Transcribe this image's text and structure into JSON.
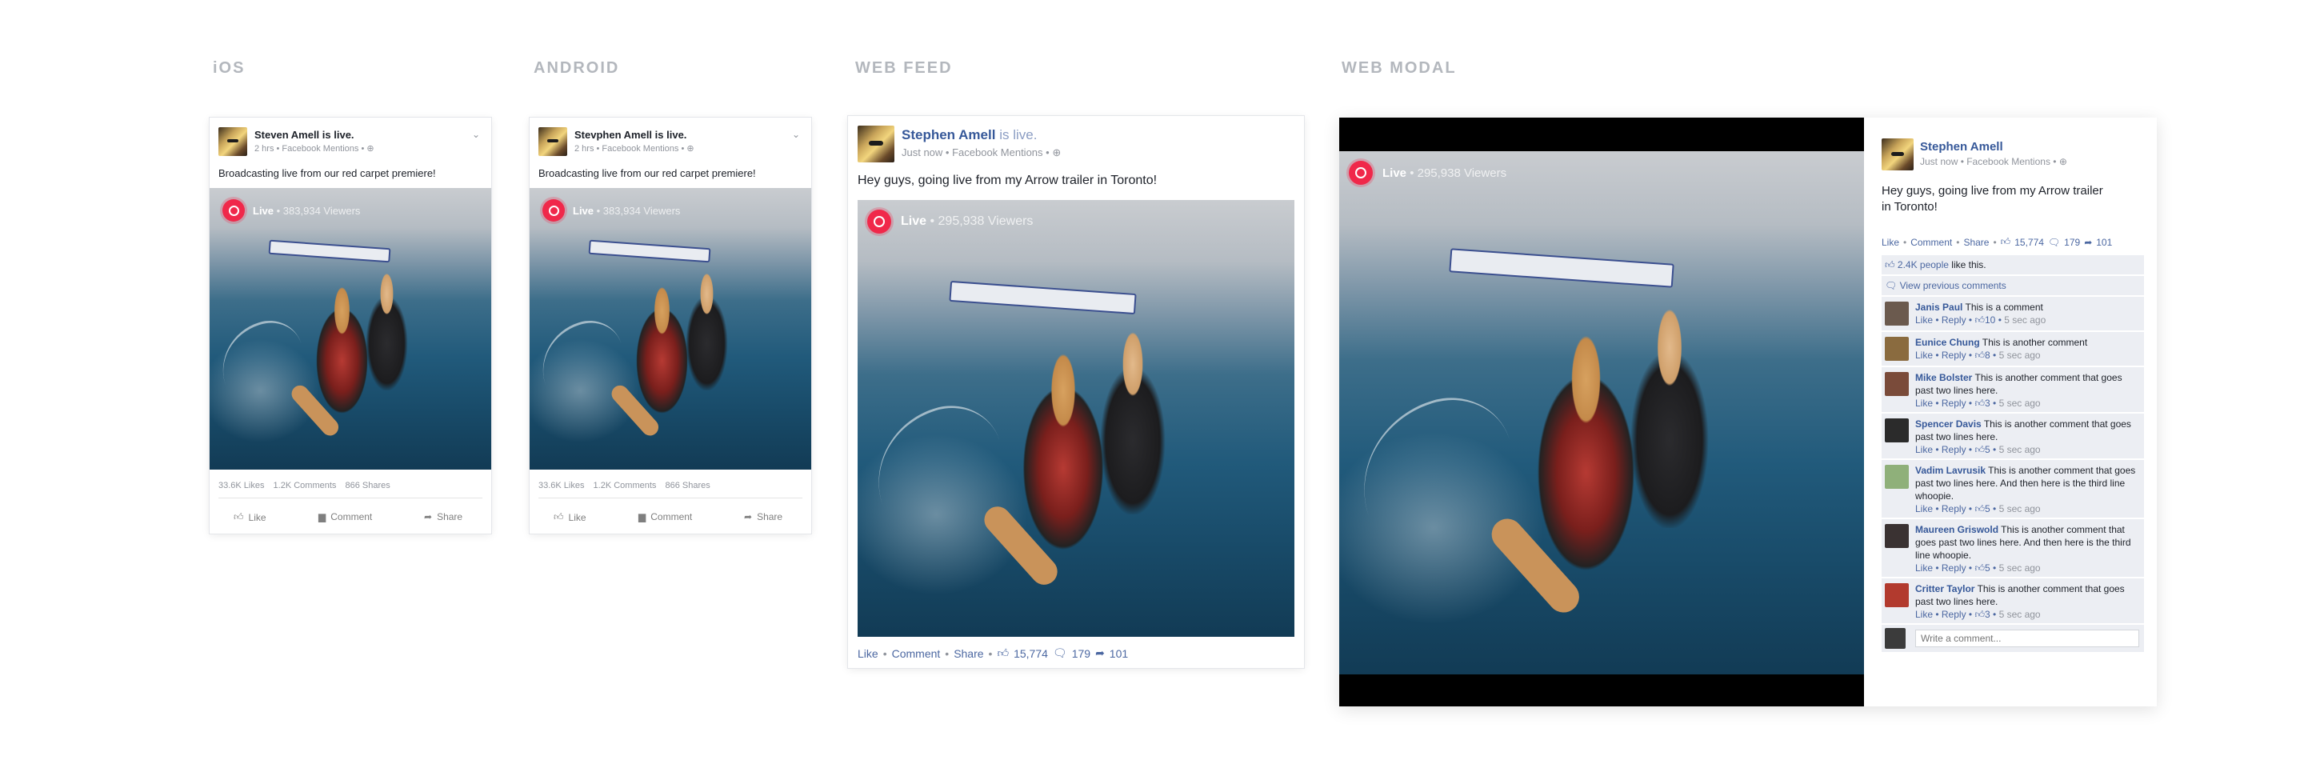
{
  "sections": {
    "ios": "iOS",
    "android": "ANDROID",
    "web_feed": "WEB FEED",
    "web_modal": "WEB MODAL"
  },
  "ios_card": {
    "author": "Steven Amell",
    "is_live_text": "is live.",
    "meta": "2 hrs • Facebook Mentions •",
    "message": "Broadcasting live from our red carpet premiere!",
    "live_label": "Live",
    "viewers": "• 383,934 Viewers",
    "stats": {
      "likes": "33.6K Likes",
      "comments": "1.2K Comments",
      "shares": "866 Shares"
    },
    "actions": {
      "like": "Like",
      "comment": "Comment",
      "share": "Share"
    }
  },
  "android_card": {
    "author": "Stevphen Amell",
    "is_live_text": "is live.",
    "meta": "2 hrs • Facebook Mentions •",
    "message": "Broadcasting live from our red carpet premiere!",
    "live_label": "Live",
    "viewers": "• 383,934 Viewers",
    "stats": {
      "likes": "33.6K Likes",
      "comments": "1.2K Comments",
      "shares": "866 Shares"
    },
    "actions": {
      "like": "Like",
      "comment": "Comment",
      "share": "Share"
    }
  },
  "feed_card": {
    "author": "Stephen Amell",
    "is_live_text": "is live.",
    "meta": "Just now • Facebook Mentions •",
    "message": "Hey guys, going live from my Arrow trailer in Toronto!",
    "live_label": "Live",
    "viewers": "• 295,938 Viewers",
    "actions": {
      "like": "Like",
      "comment": "Comment",
      "share": "Share",
      "likes_count": "15,774",
      "comments_count": "179",
      "shares_count": "101"
    }
  },
  "modal": {
    "live_label": "Live",
    "viewers": "• 295,938 Viewers",
    "author": "Stephen Amell",
    "meta": "Just now • Facebook Mentions •",
    "message": "Hey guys, going live from my Arrow trailer in Toronto!",
    "actions": {
      "like": "Like",
      "comment": "Comment",
      "share": "Share",
      "likes_count": "15,774",
      "comments_count": "179",
      "shares_count": "101"
    },
    "likes_summary": {
      "count": "2.4K people",
      "text": "like this."
    },
    "view_previous": "View previous comments",
    "comment_actions": {
      "like": "Like",
      "reply": "Reply"
    },
    "comments": [
      {
        "author": "Janis Paul",
        "text": "This is a comment",
        "likes": "10",
        "time": "5 sec ago",
        "avatar_color": "#6b5a4e"
      },
      {
        "author": "Eunice Chung",
        "text": "This is another comment",
        "likes": "8",
        "time": "5 sec ago",
        "avatar_color": "#8a6b3f"
      },
      {
        "author": "Mike Bolster",
        "text": "This is another comment that goes past two lines here.",
        "likes": "3",
        "time": "5 sec ago",
        "avatar_color": "#7a4b3a"
      },
      {
        "author": "Spencer Davis",
        "text": "This is another comment that goes past two lines here.",
        "likes": "5",
        "time": "5 sec ago",
        "avatar_color": "#2b2b2b"
      },
      {
        "author": "Vadim Lavrusik",
        "text": "This is another comment that goes past two lines here. And then here is the third line whoopie.",
        "likes": "5",
        "time": "5 sec ago",
        "avatar_color": "#8fb07a"
      },
      {
        "author": "Maureen Griswold",
        "text": "This is another comment that goes past two lines here. And then here is the third line whoopie.",
        "likes": "5",
        "time": "5 sec ago",
        "avatar_color": "#3a3232"
      },
      {
        "author": "Critter Taylor",
        "text": "This is another comment that goes past two lines here.",
        "likes": "3",
        "time": "5 sec ago",
        "avatar_color": "#b23a2e"
      }
    ],
    "write_placeholder": "Write a comment..."
  },
  "colors": {
    "fb_blue": "#365899",
    "link_blue": "#4b67a1",
    "live_red": "#f0284a",
    "meta_gray": "#90949c",
    "label_gray": "#b3b7bd"
  }
}
